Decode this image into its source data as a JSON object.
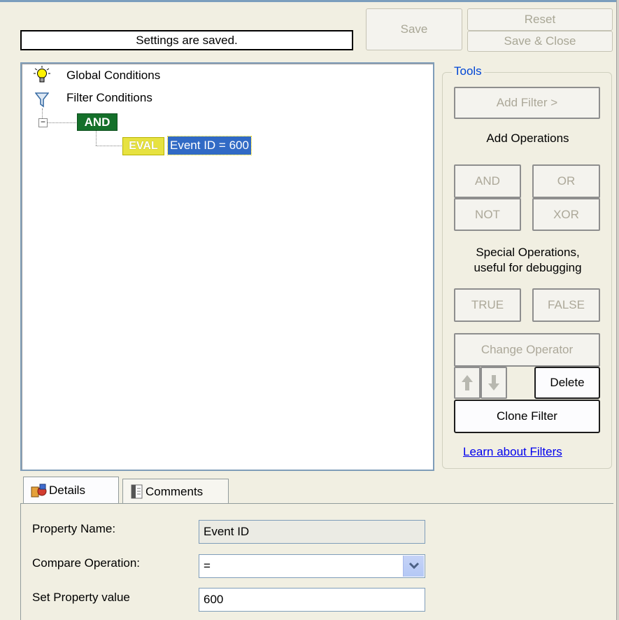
{
  "status_text": "Settings are saved.",
  "toolbar": {
    "save": "Save",
    "reset": "Reset",
    "save_close": "Save & Close"
  },
  "tree": {
    "global_conditions": "Global Conditions",
    "filter_conditions": "Filter Conditions",
    "and_badge": "AND",
    "eval_badge": "EVAL",
    "selected_expr": "Event ID = 600"
  },
  "tools": {
    "legend": "Tools",
    "add_filter": "Add Filter >",
    "add_operations": "Add Operations",
    "and": "AND",
    "or": "OR",
    "not": "NOT",
    "xor": "XOR",
    "special_line1": "Special Operations,",
    "special_line2": "useful for debugging",
    "true": "TRUE",
    "false": "FALSE",
    "change_operator": "Change Operator",
    "delete": "Delete",
    "clone_filter": "Clone Filter",
    "learn_link": "Learn about Filters"
  },
  "tabs": {
    "details": "Details",
    "comments": "Comments"
  },
  "details": {
    "property_name_label": "Property Name:",
    "property_name_value": "Event ID",
    "compare_label": "Compare Operation:",
    "compare_value": "=",
    "set_value_label": "Set Property value",
    "set_value": "600"
  }
}
